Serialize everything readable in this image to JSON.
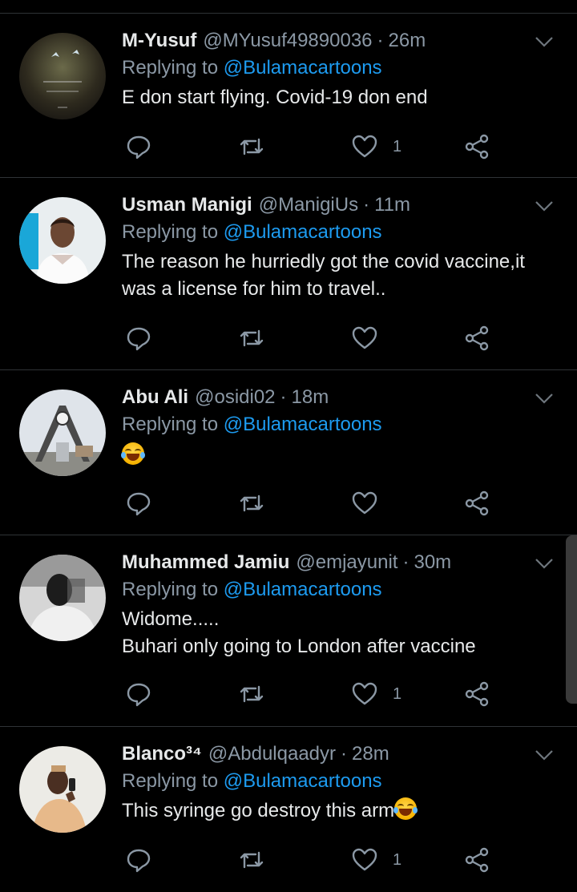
{
  "tweets": [
    {
      "name": "M-Yusuf",
      "handle": "@MYusuf49890036",
      "dot": "·",
      "time": "26m",
      "reply_prefix": "Replying to",
      "reply_to": "@Bulamacartoons",
      "lines": [
        "E don start flying. Covid-19 don end"
      ],
      "like_count": "1",
      "avatar_icon": "night-sky-avatar"
    },
    {
      "name": "Usman Manigi",
      "handle": "@ManigiUs",
      "dot": "·",
      "time": "11m",
      "reply_prefix": "Replying to",
      "reply_to": "@Bulamacartoons",
      "lines": [
        "The reason he hurriedly got the covid vaccine,it",
        "was a license for him to travel.."
      ],
      "like_count": "",
      "avatar_icon": "person-photo-avatar"
    },
    {
      "name": "Abu Ali",
      "handle": "@osidi02",
      "dot": "·",
      "time": "18m",
      "reply_prefix": "Replying to",
      "reply_to": "@Bulamacartoons",
      "lines": [],
      "emoji": "tears-of-joy-emoji",
      "like_count": "",
      "avatar_icon": "clock-tower-avatar"
    },
    {
      "name": "Muhammed Jamiu",
      "handle": "@emjayunit",
      "dot": "·",
      "time": "30m",
      "reply_prefix": "Replying to",
      "reply_to": "@Bulamacartoons",
      "lines": [
        "Widome.....",
        "Buhari only going to London after vaccine"
      ],
      "like_count": "1",
      "avatar_icon": "sketch-portrait-avatar"
    },
    {
      "name": "Blanco³⁴",
      "handle": "@Abdulqaadyr",
      "dot": "·",
      "time": "28m",
      "reply_prefix": "Replying to",
      "reply_to": "@Bulamacartoons",
      "lines": [
        "This syringe go destroy this arm"
      ],
      "trailing_emoji": "tears-of-joy-emoji",
      "like_count": "1",
      "avatar_icon": "person-phone-avatar"
    }
  ],
  "colors": {
    "background": "#000000",
    "text": "#e7e9ea",
    "secondary": "#8b98a5",
    "accent": "#1d9bf0",
    "divider": "#2f3336"
  }
}
